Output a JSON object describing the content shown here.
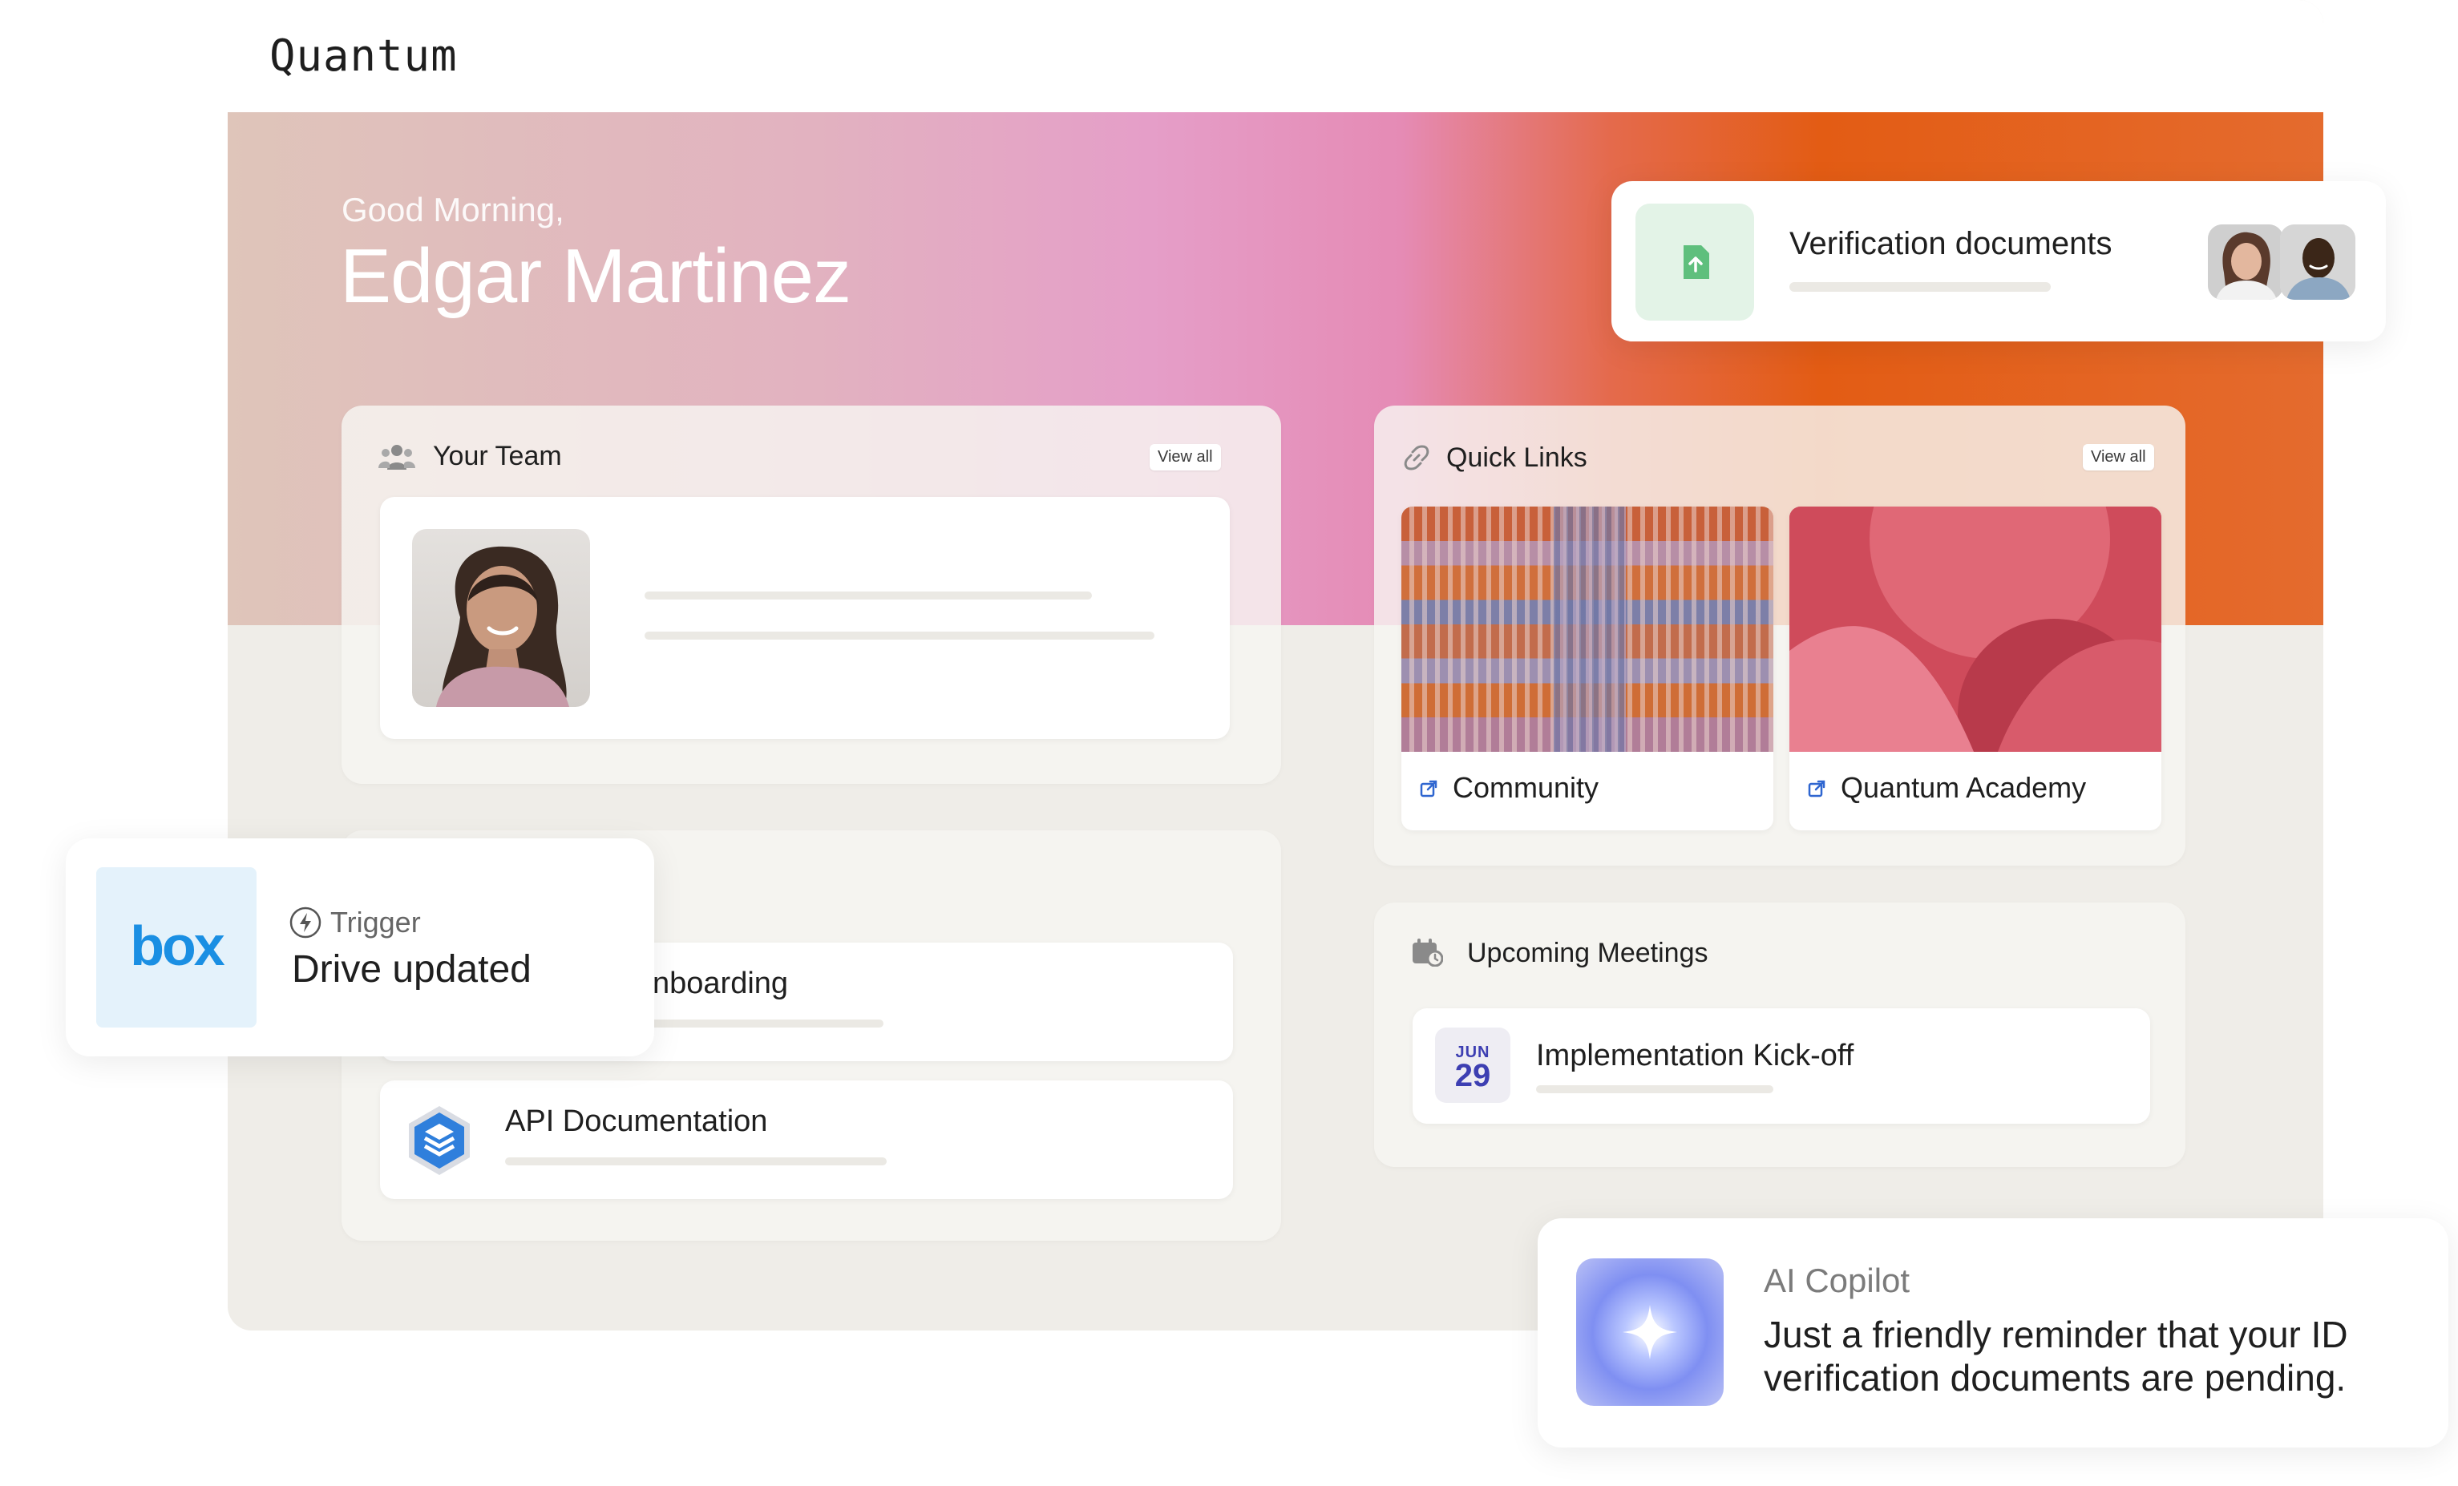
{
  "app": {
    "brand": "Quantum"
  },
  "hero": {
    "greeting": "Good Morning,",
    "user_name": "Edgar Martinez"
  },
  "team": {
    "title": "Your Team",
    "view_all": "View all"
  },
  "quick_links": {
    "title": "Quick Links",
    "view_all": "View all",
    "items": [
      {
        "label": "Community"
      },
      {
        "label": "Quantum Academy"
      }
    ]
  },
  "resources": {
    "items": [
      {
        "label": "nboarding"
      },
      {
        "label": "API Documentation"
      }
    ]
  },
  "meetings": {
    "title": "Upcoming Meetings",
    "items": [
      {
        "month": "JUN",
        "day": "29",
        "title": "Implementation Kick-off"
      }
    ]
  },
  "verification": {
    "title": "Verification documents"
  },
  "trigger": {
    "label": "Trigger",
    "title": "Drive updated",
    "logo": "box"
  },
  "copilot": {
    "label": "AI Copilot",
    "line1": "Just a friendly reminder that your ID",
    "line2": "verification documents are pending."
  },
  "colors": {
    "accent_orange": "#e35c14",
    "accent_pink": "#e59ec8",
    "box_blue": "#1a8fe3",
    "calendar_blue": "#3d3fb2",
    "upload_green": "#5fbf7d"
  },
  "icons": [
    "people-icon",
    "link-icon",
    "calendar-icon",
    "external-link-icon",
    "upload-icon",
    "lightning-icon",
    "sparkle-icon",
    "layers-icon"
  ]
}
